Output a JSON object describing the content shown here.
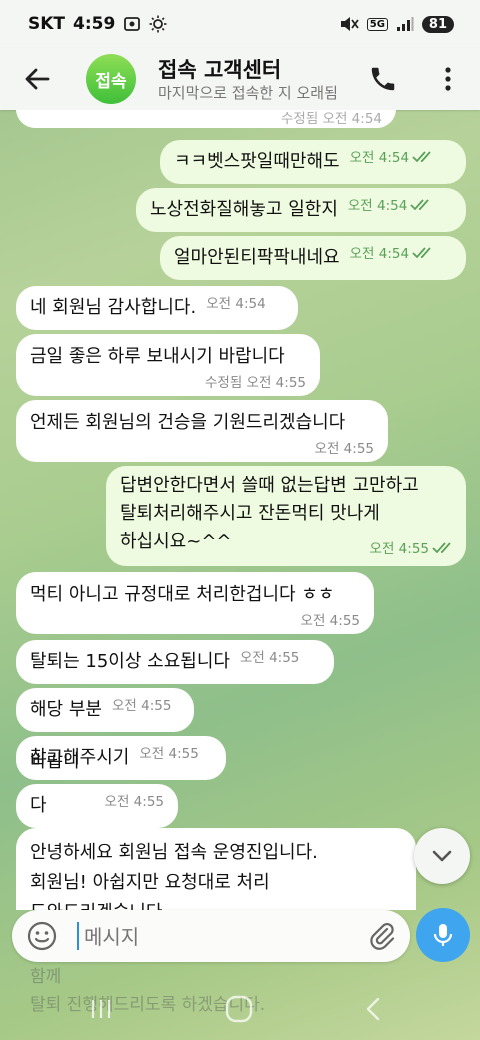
{
  "status_bar": {
    "carrier": "SKT",
    "time": "4:59",
    "battery": "81",
    "network": "5G"
  },
  "header": {
    "avatar_text": "접속",
    "title": "접속 고객센터",
    "subtitle": "마지막으로 접속한 지 오래됨"
  },
  "top_partial_meta": "수정됨 오전 4:54",
  "messages": [
    {
      "dir": "out",
      "text": "ㅋㅋ벳스팟일때만해도",
      "time": "오전 4:54"
    },
    {
      "dir": "out",
      "text": "노상전화질해놓고 일한지",
      "time": "오전 4:54"
    },
    {
      "dir": "out",
      "text": "얼마안된티팍팍내네요",
      "time": "오전 4:54"
    },
    {
      "dir": "in",
      "text": "네 회원님 감사합니다.",
      "time": "오전 4:54"
    },
    {
      "dir": "in",
      "text": "금일 좋은 하루 보내시기 바랍니다",
      "time": "수정됨 오전 4:55"
    },
    {
      "dir": "in",
      "text": "언제든 회원님의 건승을 기원드리겠습니다",
      "time": "오전 4:55"
    },
    {
      "dir": "out",
      "lines": [
        "답변안한다면서 쓸때 없는답변 고만하고",
        "탈퇴처리해주시고 잔돈먹티 맛나게",
        "하십시요~^^"
      ],
      "time": "오전 4:55"
    },
    {
      "dir": "in",
      "text": "먹티 아니고 규정대로 처리한겁니다 ㅎㅎ",
      "time": "오전 4:55"
    },
    {
      "dir": "in",
      "text": "탈퇴는 15이상 소요됩니다",
      "time": "오전 4:55"
    },
    {
      "dir": "in",
      "text": "해당 부분",
      "time": "오전 4:55"
    },
    {
      "dir": "in",
      "text": "참고해주시기",
      "time": "오전 4:55"
    },
    {
      "dir": "in",
      "text": "바랍니다",
      "time": "오전 4:55"
    },
    {
      "dir": "in",
      "lines": [
        "안녕하세요 회원님 접속 운영진입니다.",
        "회원님! 아쉽지만 요청대로 처리",
        "도와드리겠습니다"
      ]
    }
  ],
  "behind_text": [
    "함께",
    "탈퇴 진행해드리도록 하겠습니다."
  ],
  "input": {
    "placeholder": "메시지"
  },
  "icons": {
    "back": "arrow-left-icon",
    "call": "phone-icon",
    "more": "more-vert-icon",
    "emoji": "emoji-icon",
    "attach": "paperclip-icon",
    "mic": "microphone-icon",
    "scroll": "chevron-down-icon"
  }
}
